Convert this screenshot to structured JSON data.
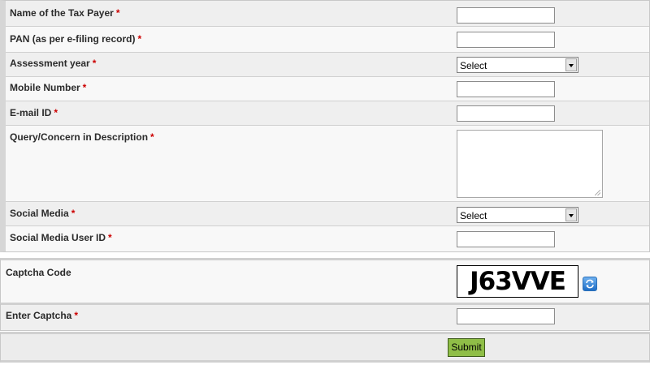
{
  "form": {
    "required_mark": "*",
    "name": {
      "label": "Name of the Tax Payer",
      "value": ""
    },
    "pan": {
      "label": "PAN (as per e-filing record)",
      "value": ""
    },
    "assessment_year": {
      "label": "Assessment year",
      "selected": "Select"
    },
    "mobile": {
      "label": "Mobile Number",
      "value": ""
    },
    "email": {
      "label": "E-mail ID",
      "value": ""
    },
    "query": {
      "label": "Query/Concern in Description",
      "value": ""
    },
    "social_media": {
      "label": "Social Media",
      "selected": "Select"
    },
    "social_media_user_id": {
      "label": "Social Media User ID",
      "value": ""
    }
  },
  "captcha": {
    "label": "Captcha Code",
    "code": "J63VVE",
    "refresh_icon": "refresh-icon"
  },
  "enter_captcha": {
    "label": "Enter Captcha",
    "value": ""
  },
  "submit": {
    "label": "Submit"
  },
  "colors": {
    "required": "#cc0000",
    "submit_bg": "#8fbe47",
    "refresh_icon": "#1f6ec6"
  }
}
